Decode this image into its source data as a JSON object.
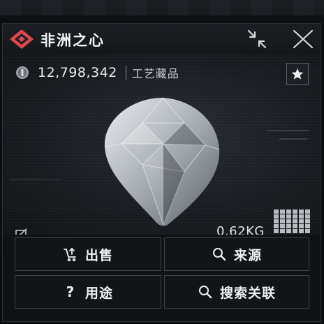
{
  "item": {
    "title": "非洲之心",
    "price": "12,798,342",
    "category": "工艺藏品",
    "weight": "0.62KG"
  },
  "actions": {
    "sell": "出售",
    "source": "来源",
    "usage": "用途",
    "search_related": "搜索关联"
  },
  "icons": {
    "logo": "diamond-logo-icon",
    "collapse": "collapse-arrows-icon",
    "close": "close-x-icon",
    "coin": "coin-icon",
    "favorite": "star-icon",
    "no_display": "no-display-icon",
    "grid": "grid-size-icon",
    "sell": "sell-icon",
    "search": "search-icon",
    "help": "question-icon"
  },
  "colors": {
    "accent": "#e0474c",
    "panel_bg": "#101316",
    "border": "#3a4047"
  }
}
